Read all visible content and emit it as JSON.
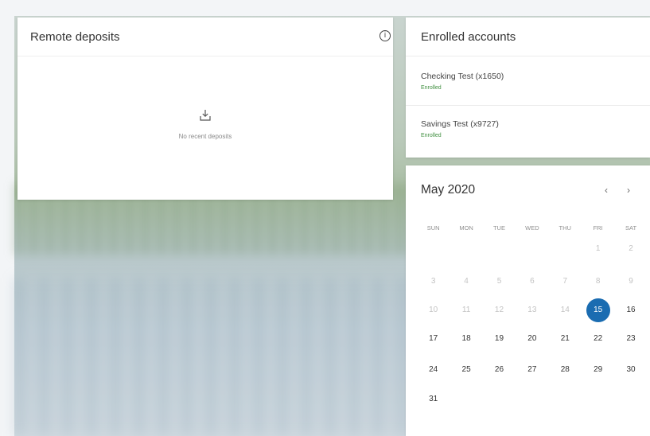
{
  "remote_deposits": {
    "title": "Remote deposits",
    "info_icon": "info-icon",
    "empty_icon": "download-tray-icon",
    "empty_text": "No recent deposits"
  },
  "enrolled_accounts": {
    "title": "Enrolled accounts",
    "accounts": [
      {
        "name": "Checking Test (x1650)",
        "status": "Enrolled"
      },
      {
        "name": "Savings Test (x9727)",
        "status": "Enrolled"
      }
    ]
  },
  "calendar": {
    "month_label": "May 2020",
    "prev_icon": "chevron-left-icon",
    "next_icon": "chevron-right-icon",
    "prev_glyph": "‹",
    "next_glyph": "›",
    "weekdays": [
      "SUN",
      "MON",
      "TUE",
      "WED",
      "THU",
      "FRI",
      "SAT"
    ],
    "weeks": [
      [
        "",
        "",
        "",
        "",
        "",
        "1",
        "2"
      ],
      [
        "3",
        "4",
        "5",
        "6",
        "7",
        "8",
        "9"
      ],
      [
        "10",
        "11",
        "12",
        "13",
        "14",
        "15",
        "16"
      ],
      [
        "17",
        "18",
        "19",
        "20",
        "21",
        "22",
        "23"
      ],
      [
        "24",
        "25",
        "26",
        "27",
        "28",
        "29",
        "30"
      ],
      [
        "31",
        "",
        "",
        "",
        "",
        "",
        ""
      ]
    ],
    "selected_day": "15",
    "selected_color": "#1a6cb1"
  }
}
